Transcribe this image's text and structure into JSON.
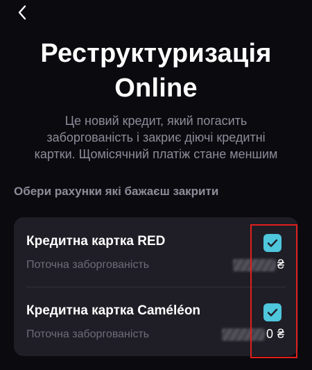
{
  "header": {
    "back_icon": "chevron-left-icon",
    "title_line1": "Реструктуризація",
    "title_line2": "Online",
    "subtitle": "Це новий кредит, який погасить заборгованість і закриє діючі кредитні картки. Щомісячний платіж стане меншим"
  },
  "section": {
    "label": "Обери рахунки які бажаєш закрити"
  },
  "accounts": [
    {
      "title": "Кредитна картка RED",
      "subtitle": "Поточна заборгованість",
      "amount_visible": "",
      "currency": "₴",
      "checked": true
    },
    {
      "title": "Кредитна картка Caméléon",
      "subtitle": "Поточна заборгованість",
      "amount_visible": "0",
      "currency": "₴",
      "checked": true
    }
  ],
  "colors": {
    "background": "#0b0a0f",
    "card": "#1f1e26",
    "accent": "#4ec6dc",
    "muted_text": "#8e8c99",
    "highlight": "#e0201c"
  }
}
